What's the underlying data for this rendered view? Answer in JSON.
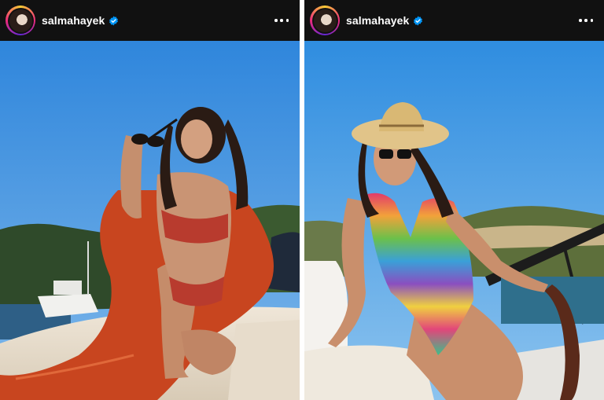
{
  "posts": [
    {
      "username": "salmahayek",
      "verified": true,
      "icons": {
        "avatar": "profile-avatar",
        "verified": "verified-badge-icon",
        "more": "more-options-icon"
      },
      "colors": {
        "header_bg": "#111111",
        "verified_blue": "#0095f6",
        "sky": "#3d8fe0"
      }
    },
    {
      "username": "salmahayek",
      "verified": true,
      "icons": {
        "avatar": "profile-avatar",
        "verified": "verified-badge-icon",
        "more": "more-options-icon"
      },
      "colors": {
        "header_bg": "#111111",
        "verified_blue": "#0095f6",
        "sky": "#3d8fe0"
      }
    }
  ]
}
